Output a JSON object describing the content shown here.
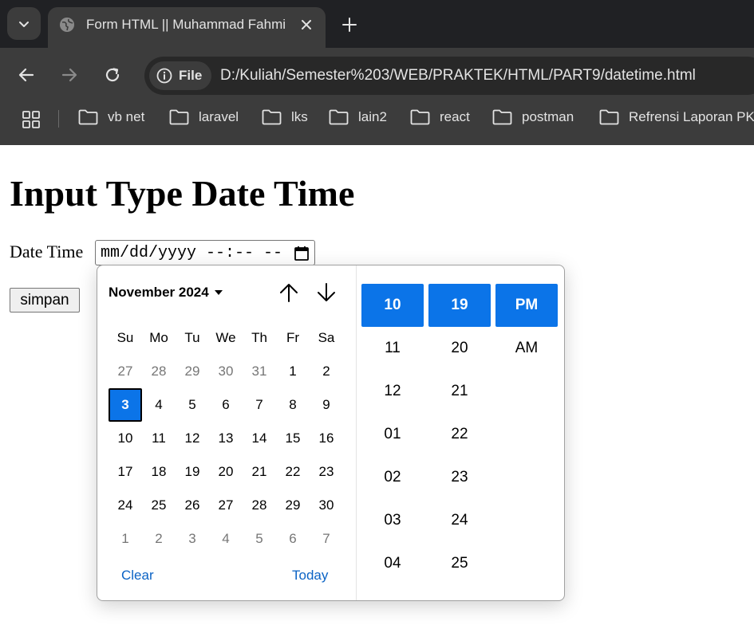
{
  "browser": {
    "tab_title": "Form HTML || Muhammad Fahmi",
    "site_chip": "File",
    "url": "D:/Kuliah/Semester%203/WEB/PRAKTEK/HTML/PART9/datetime.html",
    "bookmarks": [
      "vb net",
      "laravel",
      "lks",
      "lain2",
      "react",
      "postman",
      "Refrensi Laporan PKL"
    ]
  },
  "page": {
    "heading": "Input Type Date Time",
    "label": "Date Time",
    "input_placeholder": "mm/dd/yyyy --:-- --",
    "submit_label": "simpan"
  },
  "picker": {
    "month_label": "November 2024",
    "weekdays": [
      "Su",
      "Mo",
      "Tu",
      "We",
      "Th",
      "Fr",
      "Sa"
    ],
    "weeks": [
      [
        "27",
        "28",
        "29",
        "30",
        "31",
        "1",
        "2"
      ],
      [
        "3",
        "4",
        "5",
        "6",
        "7",
        "8",
        "9"
      ],
      [
        "10",
        "11",
        "12",
        "13",
        "14",
        "15",
        "16"
      ],
      [
        "17",
        "18",
        "19",
        "20",
        "21",
        "22",
        "23"
      ],
      [
        "24",
        "25",
        "26",
        "27",
        "28",
        "29",
        "30"
      ],
      [
        "1",
        "2",
        "3",
        "4",
        "5",
        "6",
        "7"
      ]
    ],
    "selected_day": "3",
    "clear_label": "Clear",
    "today_label": "Today",
    "hours": [
      "10",
      "11",
      "12",
      "01",
      "02",
      "03",
      "04"
    ],
    "minutes": [
      "19",
      "20",
      "21",
      "22",
      "23",
      "24",
      "25"
    ],
    "meridiem": [
      "PM",
      "AM"
    ],
    "selected_hour": "10",
    "selected_minute": "19",
    "selected_meridiem": "PM"
  },
  "colors": {
    "accent": "#0b74e8",
    "link": "#0b63c5",
    "chrome_dark": "#202124",
    "chrome_toolbar": "#3c3c3c"
  }
}
